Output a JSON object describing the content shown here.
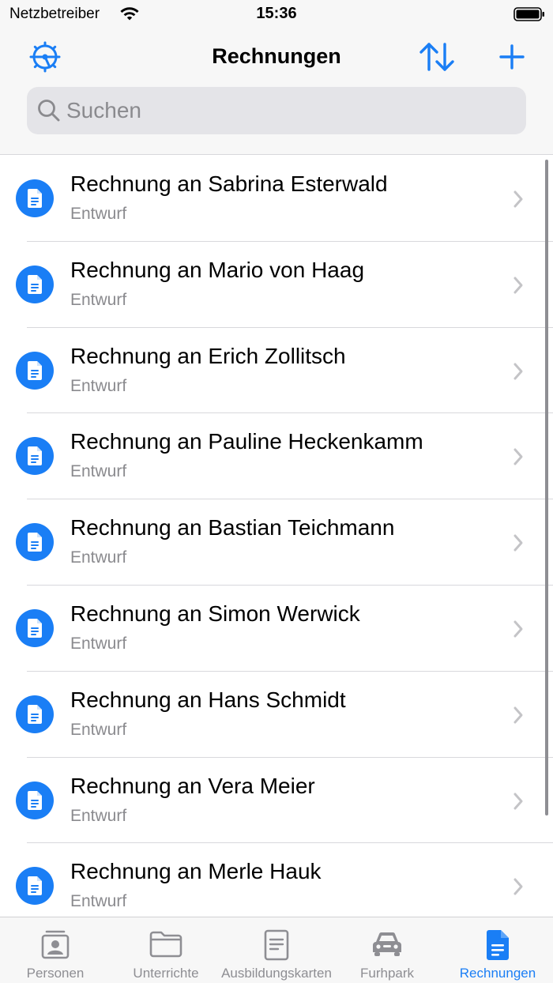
{
  "status_bar": {
    "carrier": "Netzbetreiber",
    "time": "15:36"
  },
  "header": {
    "title": "Rechnungen"
  },
  "search": {
    "placeholder": "Suchen"
  },
  "colors": {
    "accent": "#1a7ef5",
    "secondary_text": "#8a8a8e",
    "background": "#f7f7f7"
  },
  "invoices": [
    {
      "title": "Rechnung an Sabrina Esterwald",
      "status": "Entwurf"
    },
    {
      "title": "Rechnung an Mario von Haag",
      "status": "Entwurf"
    },
    {
      "title": "Rechnung an Erich Zollitsch",
      "status": "Entwurf"
    },
    {
      "title": "Rechnung an Pauline Heckenkamm",
      "status": "Entwurf"
    },
    {
      "title": "Rechnung an Bastian Teichmann",
      "status": "Entwurf"
    },
    {
      "title": "Rechnung an Simon Werwick",
      "status": "Entwurf"
    },
    {
      "title": "Rechnung an Hans Schmidt",
      "status": "Entwurf"
    },
    {
      "title": "Rechnung an Vera Meier",
      "status": "Entwurf"
    },
    {
      "title": "Rechnung an Merle Hauk",
      "status": "Entwurf"
    }
  ],
  "tabs": [
    {
      "label": "Personen",
      "icon": "person-card-icon",
      "active": false
    },
    {
      "label": "Unterrichte",
      "icon": "folder-icon",
      "active": false
    },
    {
      "label": "Ausbildungskarten",
      "icon": "document-icon",
      "active": false
    },
    {
      "label": "Furhpark",
      "icon": "car-icon",
      "active": false
    },
    {
      "label": "Rechnungen",
      "icon": "document-filled-icon",
      "active": true
    }
  ]
}
